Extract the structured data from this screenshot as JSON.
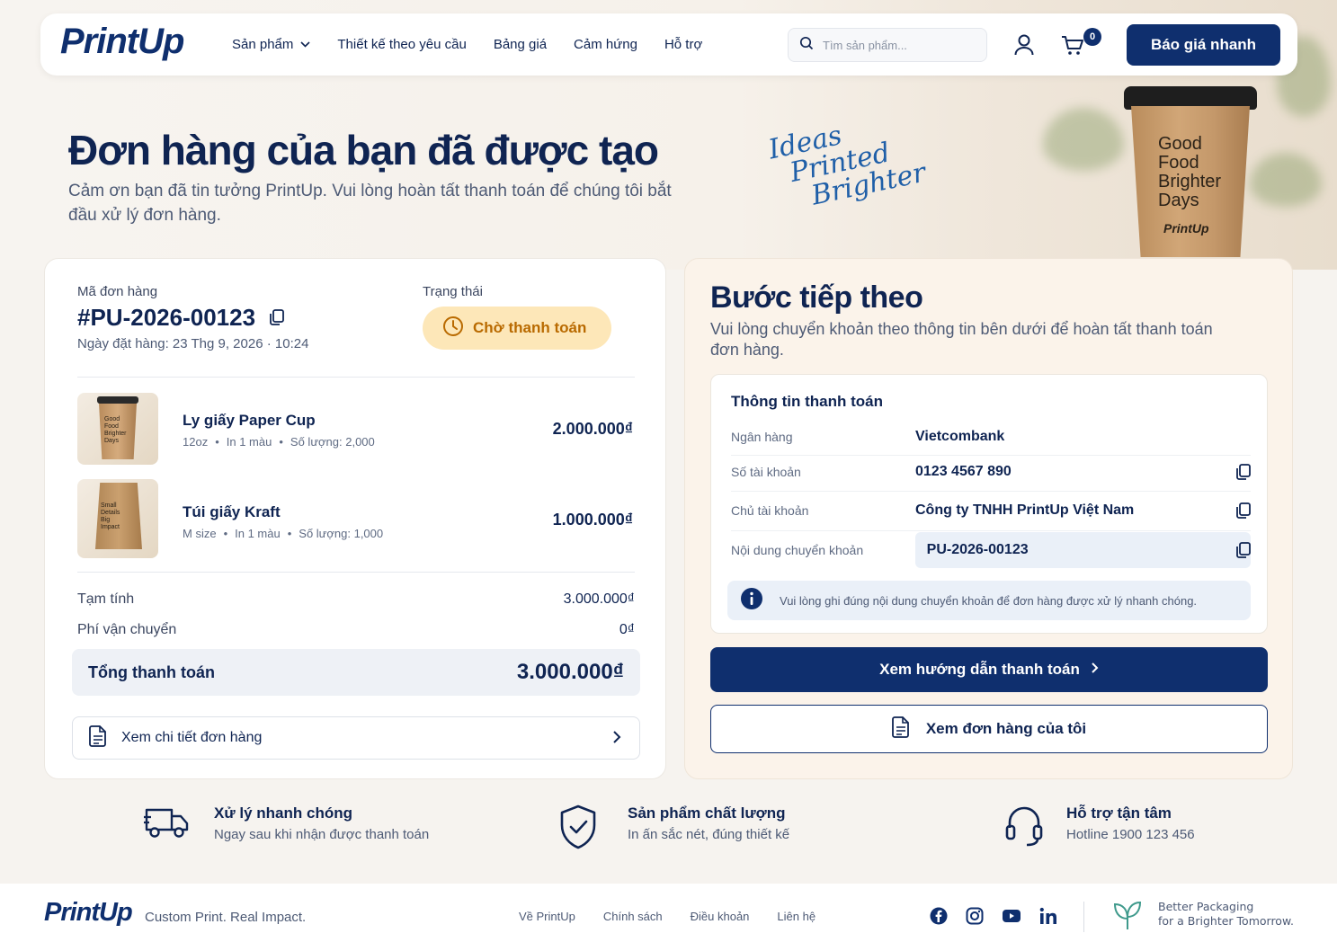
{
  "nav": {
    "logo": "PrintUp",
    "menu": [
      {
        "label": "Sản phẩm",
        "has_dropdown": true
      },
      {
        "label": "Thiết kế theo yêu cầu"
      },
      {
        "label": "Bảng giá"
      },
      {
        "label": "Cảm hứng"
      },
      {
        "label": "Hỗ trợ"
      }
    ],
    "search_placeholder": "Tìm sản phẩm...",
    "cart_count": "0",
    "cta_label": "Báo giá nhanh"
  },
  "hero": {
    "title": "Đơn hàng của bạn đã được tạo",
    "subtitle": "Cảm ơn bạn đã tin tưởng PrintUp. Vui lòng hoàn tất thanh toán để chúng tôi bắt đầu xử lý đơn hàng.",
    "script_lines": [
      "Ideas",
      "Printed",
      "Brighter"
    ],
    "cup_text": [
      "Good",
      "Food",
      "Brighter",
      "Days"
    ],
    "cup_brand": "PrintUp"
  },
  "order": {
    "id_label": "Mã đơn hàng",
    "id": "#PU-2026-00123",
    "date": "Ngày đặt hàng: 23 Thg 9, 2026 · 10:24",
    "status_label": "Trạng thái",
    "status": "Chờ thanh toán",
    "items": [
      {
        "name": "Ly giấy Paper Cup",
        "meta": [
          "12oz",
          "In 1 màu",
          "Số lượng: 2,000"
        ],
        "price": "2.000.000₫",
        "thumb_text": "Good Food Brighter Days"
      },
      {
        "name": "Túi giấy Kraft",
        "meta": [
          "M size",
          "In 1 màu",
          "Số lượng: 1,000"
        ],
        "price": "1.000.000₫",
        "thumb_text": "Small Details Big Impact"
      }
    ],
    "subtotal_label": "Tạm tính",
    "subtotal": "3.000.000₫",
    "shipping_label": "Phí vận chuyển",
    "shipping": "0₫",
    "total_label": "Tổng thanh toán",
    "total": "3.000.000₫",
    "detail_link": "Xem chi tiết đơn hàng"
  },
  "next_step": {
    "title": "Bước tiếp theo",
    "subtitle": "Vui lòng chuyển khoản theo thông tin bên dưới để hoàn tất thanh toán đơn hàng.",
    "payment_title": "Thông tin thanh toán",
    "rows": [
      {
        "label": "Ngân hàng",
        "value": "Vietcombank"
      },
      {
        "label": "Số tài khoản",
        "value": "0123 4567 890"
      },
      {
        "label": "Chủ tài khoản",
        "value": "Công ty TNHH PrintUp Việt Nam"
      },
      {
        "label": "Nội dung chuyển khoản",
        "value": "PU-2026-00123"
      }
    ],
    "note": "Vui lòng ghi đúng nội dung chuyển khoản để đơn hàng được xử lý nhanh chóng.",
    "guide_button": "Xem hướng dẫn thanh toán",
    "my_orders_button": "Xem đơn hàng của tôi"
  },
  "features": [
    {
      "title": "Xử lý nhanh chóng",
      "desc": "Ngay sau khi nhận được thanh toán",
      "icon": "truck-icon"
    },
    {
      "title": "Sản phẩm chất lượng",
      "desc": "In ấn sắc nét, đúng thiết kế",
      "icon": "shield-check-icon"
    },
    {
      "title": "Hỗ trợ tận tâm",
      "desc": "Hotline 1900 123 456",
      "icon": "headset-icon"
    }
  ],
  "footer": {
    "logo": "PrintUp",
    "tagline": "Custom Print. Real Impact.",
    "links": [
      "Về PrintUp",
      "Chính sách",
      "Điều khoản",
      "Liên hệ"
    ],
    "social": [
      "facebook-icon",
      "instagram-icon",
      "youtube-icon",
      "linkedin-icon"
    ],
    "eco_line1": "Better Packaging",
    "eco_line2": "for a Brighter Tomorrow."
  },
  "colors": {
    "brand_navy": "#0f2f6e",
    "text_navy": "#0f2452",
    "status_bg": "#fde7b8",
    "status_text": "#b96a00",
    "page_bg": "#f6f3ef"
  }
}
